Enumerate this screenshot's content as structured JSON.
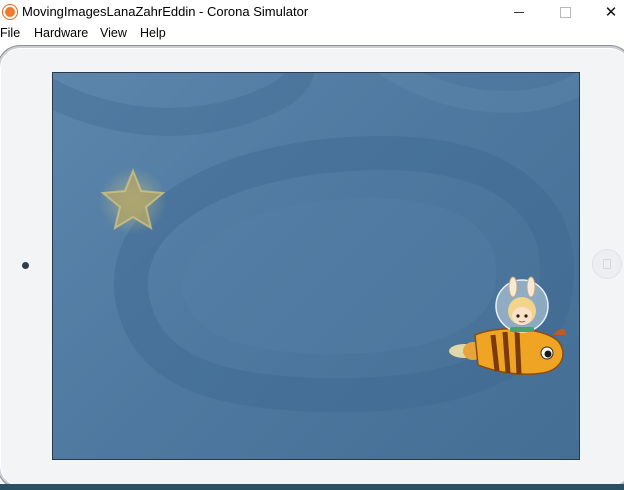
{
  "window": {
    "title": "MovingImagesLanaZahrEddin - Corona Simulator",
    "app_icon": "corona-icon",
    "controls": {
      "minimize": "minimize-icon",
      "maximize": "maximize-icon",
      "close": "close-icon"
    }
  },
  "menu": {
    "items": [
      {
        "label": "File"
      },
      {
        "label": "Hardware"
      },
      {
        "label": "View"
      },
      {
        "label": "Help"
      }
    ]
  },
  "device": {
    "type": "tablet-landscape",
    "bezel_color": "#f3f4f6",
    "screen": {
      "background_color": "#5a82a8",
      "sprites": [
        {
          "name": "star",
          "icon": "star-icon",
          "color": "#c9b56a"
        },
        {
          "name": "rocket-bunny",
          "icon": "rocket-bunny-icon",
          "color": "#f0a020"
        }
      ]
    }
  }
}
